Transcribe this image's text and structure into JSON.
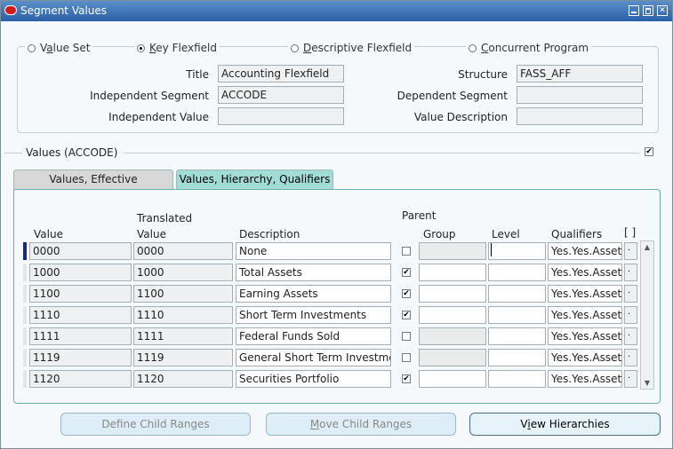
{
  "window": {
    "title": "Segment Values"
  },
  "radio": [
    {
      "pre": "",
      "u": "",
      "text": "Value Set",
      "selected": false
    },
    {
      "pre": "",
      "u": "K",
      "text": "ey Flexfield",
      "selected": true
    },
    {
      "pre": "",
      "u": "D",
      "text": "escriptive Flexfield",
      "selected": false
    },
    {
      "pre": "",
      "u": "C",
      "text": "oncurrent Program",
      "selected": false
    }
  ],
  "radio_valueset": {
    "a": "V",
    "b": "a",
    "c": "lue Set"
  },
  "fields": {
    "title_label": "Title",
    "title_value": "Accounting Flexfield",
    "structure_label": "Structure",
    "structure_value": "FASS_AFF",
    "indep_seg_label": "Independent Segment",
    "indep_seg_value": "ACCODE",
    "dep_seg_label": "Dependent Segment",
    "dep_seg_value": "",
    "indep_val_label": "Independent Value",
    "indep_val_value": "",
    "val_desc_label": "Value Description",
    "val_desc_value": ""
  },
  "values_section": {
    "title": "Values (ACCODE)",
    "checked": true
  },
  "tabs": [
    {
      "label": "Values, Effective",
      "active": false
    },
    {
      "label": "Values, Hierarchy, Qualifiers",
      "active": true
    }
  ],
  "columns": {
    "value": "Value",
    "translated_top": "Translated",
    "translated_bottom": "Value",
    "description": "Description",
    "parent": "Parent",
    "group": "Group",
    "level": "Level",
    "qualifiers": "Qualifiers",
    "brackets": "[ ]"
  },
  "rows": [
    {
      "value": "0000",
      "translated": "0000",
      "description": "None",
      "parent": false,
      "group": "",
      "level": "",
      "qualifiers": "Yes.Yes.Asset",
      "extra": "."
    },
    {
      "value": "1000",
      "translated": "1000",
      "description": "Total Assets",
      "parent": true,
      "group": "",
      "level": "",
      "qualifiers": "Yes.Yes.Asset",
      "extra": "."
    },
    {
      "value": "1100",
      "translated": "1100",
      "description": "Earning Assets",
      "parent": true,
      "group": "",
      "level": "",
      "qualifiers": "Yes.Yes.Asset",
      "extra": "."
    },
    {
      "value": "1110",
      "translated": "1110",
      "description": "Short Term Investments",
      "parent": true,
      "group": "",
      "level": "",
      "qualifiers": "Yes.Yes.Asset",
      "extra": "."
    },
    {
      "value": "1111",
      "translated": "1111",
      "description": "Federal Funds Sold",
      "parent": false,
      "group": "",
      "level": "",
      "qualifiers": "Yes.Yes.Asset",
      "extra": "."
    },
    {
      "value": "1119",
      "translated": "1119",
      "description": "General Short Term Investmer",
      "parent": false,
      "group": "",
      "level": "",
      "qualifiers": "Yes.Yes.Asset",
      "extra": "."
    },
    {
      "value": "1120",
      "translated": "1120",
      "description": "Securities Portfolio",
      "parent": true,
      "group": "",
      "level": "",
      "qualifiers": "Yes.Yes.Asset",
      "extra": "."
    }
  ],
  "buttons": {
    "define_a": "Def",
    "define_u": "i",
    "define_b": "ne Child Ranges",
    "move_a": "",
    "move_u": "M",
    "move_b": "ove Child Ranges",
    "view_a": "V",
    "view_u": "i",
    "view_b": "ew Hierarchies"
  },
  "icons": {
    "app": "oracle-icon",
    "minimize": "minimize-icon",
    "maximize": "maximize-icon",
    "close": "close-icon",
    "scroll_up": "arrow-up-icon",
    "scroll_down": "arrow-down-icon"
  }
}
